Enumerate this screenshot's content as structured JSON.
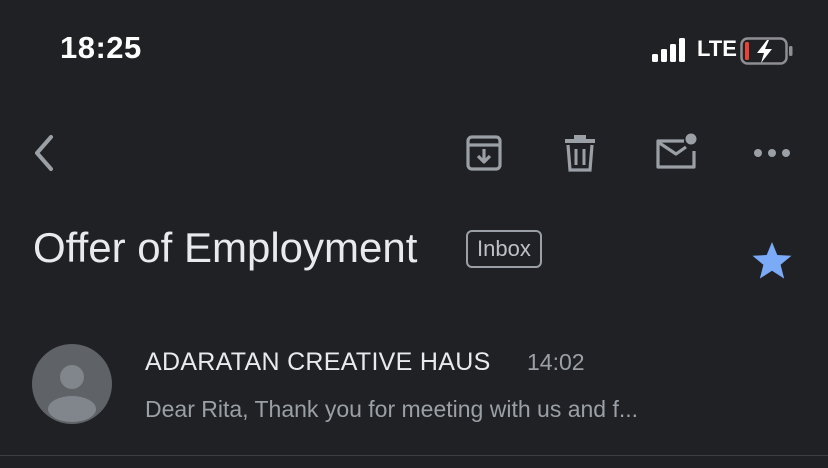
{
  "status_bar": {
    "time": "18:25",
    "network": "LTE",
    "signal_bars": 4,
    "charging": true
  },
  "toolbar": {
    "back_icon": "chevron-left-icon",
    "archive_icon": "archive-icon",
    "delete_icon": "trash-icon",
    "mark_unread_icon": "mail-unread-icon",
    "more_icon": "more-horizontal-icon"
  },
  "email": {
    "subject": "Offer of Employment",
    "label": "Inbox",
    "starred": true,
    "star_color": "#7baaf7"
  },
  "message": {
    "sender": "ADARATAN CREATIVE HAUS",
    "time": "14:02",
    "snippet": "Dear Rita, Thank you for meeting with us and f..."
  },
  "colors": {
    "background": "#202124",
    "text_primary": "#e8eaed",
    "text_secondary": "#9aa0a6",
    "icon": "#9aa0a6",
    "battery_low": "#ea4335"
  }
}
